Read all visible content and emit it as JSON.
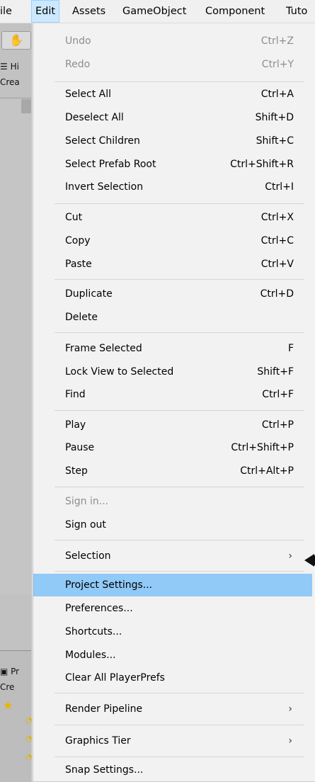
{
  "menubar": {
    "items": [
      {
        "label": "ile"
      },
      {
        "label": "Edit"
      },
      {
        "label": "Assets"
      },
      {
        "label": "GameObject"
      },
      {
        "label": "Component"
      },
      {
        "label": "Tuto"
      }
    ]
  },
  "background": {
    "hand_icon": "✋",
    "hierarchy_tab": "☰ Hi",
    "create_top": "Crea",
    "project_tab": "▣ Pr",
    "create_bottom": "Cre"
  },
  "menu": {
    "undo": {
      "label": "Undo",
      "shortcut": "Ctrl+Z"
    },
    "redo": {
      "label": "Redo",
      "shortcut": "Ctrl+Y"
    },
    "select_all": {
      "label": "Select All",
      "shortcut": "Ctrl+A"
    },
    "deselect_all": {
      "label": "Deselect All",
      "shortcut": "Shift+D"
    },
    "select_children": {
      "label": "Select Children",
      "shortcut": "Shift+C"
    },
    "select_prefab_root": {
      "label": "Select Prefab Root",
      "shortcut": "Ctrl+Shift+R"
    },
    "invert_selection": {
      "label": "Invert Selection",
      "shortcut": "Ctrl+I"
    },
    "cut": {
      "label": "Cut",
      "shortcut": "Ctrl+X"
    },
    "copy": {
      "label": "Copy",
      "shortcut": "Ctrl+C"
    },
    "paste": {
      "label": "Paste",
      "shortcut": "Ctrl+V"
    },
    "duplicate": {
      "label": "Duplicate",
      "shortcut": "Ctrl+D"
    },
    "delete": {
      "label": "Delete"
    },
    "frame_selected": {
      "label": "Frame Selected",
      "shortcut": "F"
    },
    "lock_view": {
      "label": "Lock View to Selected",
      "shortcut": "Shift+F"
    },
    "find": {
      "label": "Find",
      "shortcut": "Ctrl+F"
    },
    "play": {
      "label": "Play",
      "shortcut": "Ctrl+P"
    },
    "pause": {
      "label": "Pause",
      "shortcut": "Ctrl+Shift+P"
    },
    "step": {
      "label": "Step",
      "shortcut": "Ctrl+Alt+P"
    },
    "sign_in": {
      "label": "Sign in..."
    },
    "sign_out": {
      "label": "Sign out"
    },
    "selection": {
      "label": "Selection"
    },
    "project_settings": {
      "label": "Project Settings..."
    },
    "preferences": {
      "label": "Preferences..."
    },
    "shortcuts": {
      "label": "Shortcuts..."
    },
    "modules": {
      "label": "Modules..."
    },
    "clear_playerprefs": {
      "label": "Clear All PlayerPrefs"
    },
    "render_pipeline": {
      "label": "Render Pipeline"
    },
    "graphics_tier": {
      "label": "Graphics Tier"
    },
    "snap_settings": {
      "label": "Snap Settings..."
    },
    "submenu_arrow": "›"
  },
  "colors": {
    "highlight": "#91c9f7",
    "active_menubar": "#cce8ff",
    "disabled_text": "#8d8d8d"
  }
}
